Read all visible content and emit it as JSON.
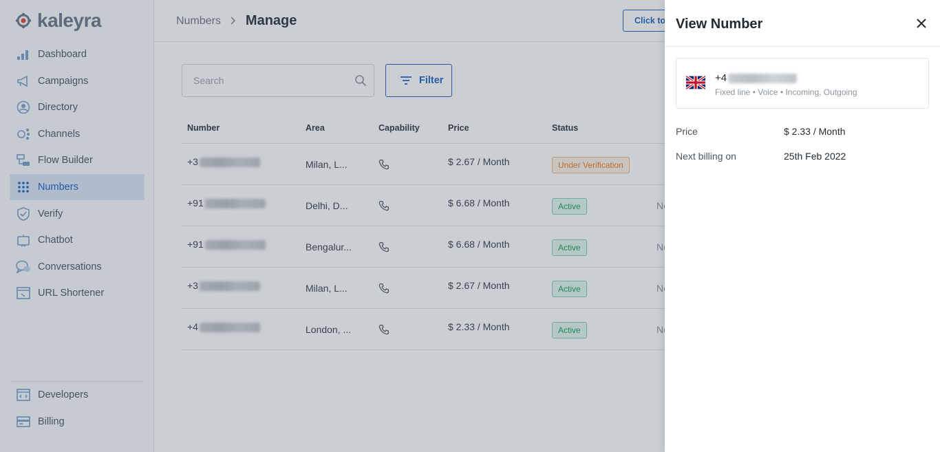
{
  "brand": {
    "name": "kaleyra",
    "accent": "#1f63c2"
  },
  "sidebar": {
    "items": [
      {
        "label": "Dashboard",
        "icon": "dashboard-icon"
      },
      {
        "label": "Campaigns",
        "icon": "megaphone-icon"
      },
      {
        "label": "Directory",
        "icon": "contact-icon"
      },
      {
        "label": "Channels",
        "icon": "channels-icon"
      },
      {
        "label": "Flow Builder",
        "icon": "flow-icon"
      },
      {
        "label": "Numbers",
        "icon": "dialpad-icon"
      },
      {
        "label": "Verify",
        "icon": "shield-icon"
      },
      {
        "label": "Chatbot",
        "icon": "bot-icon"
      },
      {
        "label": "Conversations",
        "icon": "chat-icon"
      },
      {
        "label": "URL Shortener",
        "icon": "link-icon"
      }
    ],
    "bottom_items": [
      {
        "label": "Developers",
        "icon": "code-icon"
      },
      {
        "label": "Billing",
        "icon": "card-icon"
      }
    ]
  },
  "header": {
    "breadcrumb_parent": "Numbers",
    "breadcrumb_current": "Manage",
    "action_label": "Click to Call"
  },
  "toolbar": {
    "search_placeholder": "Search",
    "filter_label": "Filter"
  },
  "table": {
    "columns": [
      "Number",
      "Area",
      "Capability",
      "Price",
      "Status"
    ],
    "rows": [
      {
        "number_prefix": "+3",
        "area": "Milan, L...",
        "price": "$ 2.67 / Month",
        "status": "Under Verification",
        "extra": ""
      },
      {
        "number_prefix": "+91",
        "area": "Delhi, D...",
        "price": "$ 6.68 / Month",
        "status": "Active",
        "extra": "No"
      },
      {
        "number_prefix": "+91",
        "area": "Bengalur...",
        "price": "$ 6.68 / Month",
        "status": "Active",
        "extra": "No"
      },
      {
        "number_prefix": "+3",
        "area": "Milan, L...",
        "price": "$ 2.67 / Month",
        "status": "Active",
        "extra": "No"
      },
      {
        "number_prefix": "+4",
        "area": "London, ...",
        "price": "$ 2.33 / Month",
        "status": "Active",
        "extra": "No"
      }
    ]
  },
  "drawer": {
    "title": "View Number",
    "number_prefix": "+4",
    "meta": "Fixed line • Voice • Incoming, Outgoing",
    "price_label": "Price",
    "price_value": "$ 2.33 / Month",
    "billing_label": "Next billing on",
    "billing_value": "25th Feb 2022"
  }
}
